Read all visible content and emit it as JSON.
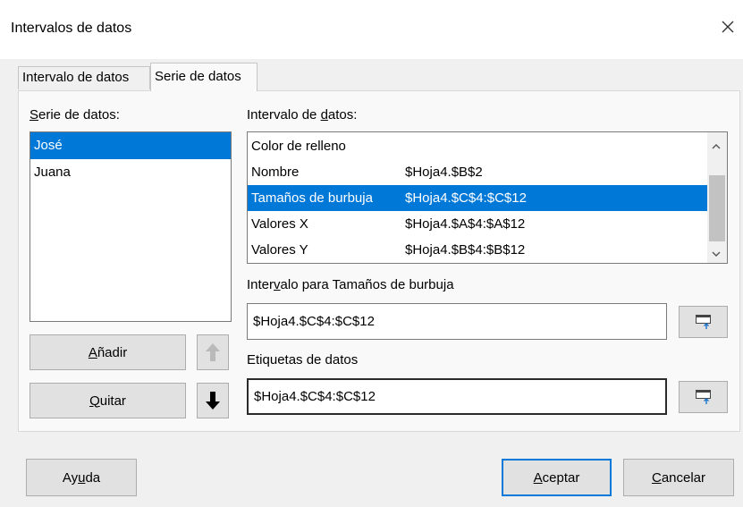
{
  "window": {
    "title": "Intervalos de datos"
  },
  "tabs": [
    {
      "label": "Intervalo de datos"
    },
    {
      "label": "Serie de datos"
    }
  ],
  "series": {
    "label": "Serie de datos:",
    "items": [
      {
        "label": "José"
      },
      {
        "label": "Juana"
      }
    ],
    "selected": "José"
  },
  "ranges": {
    "label": "Intervalo de datos:",
    "rows": [
      {
        "role": "Color de relleno",
        "range": ""
      },
      {
        "role": "Nombre",
        "range": "$Hoja4.$B$2"
      },
      {
        "role": "Tamaños de burbuja",
        "range": "$Hoja4.$C$4:$C$12"
      },
      {
        "role": "Valores X",
        "range": "$Hoja4.$A$4:$A$12"
      },
      {
        "role": "Valores Y",
        "range": "$Hoja4.$B$4:$B$12"
      }
    ]
  },
  "range_for": {
    "label": "Intervalo para Tamaños de burbuja",
    "value": "$Hoja4.$C$4:$C$12"
  },
  "data_labels": {
    "label": "Etiquetas de datos",
    "value": "$Hoja4.$C$4:$C$12"
  },
  "buttons": {
    "add": "Añadir",
    "remove": "Quitar",
    "help": "Ayuda",
    "ok": "Aceptar",
    "cancel": "Cancelar"
  },
  "icons": {
    "close": "close-icon",
    "up": "arrow-up-icon",
    "down": "arrow-down-icon",
    "select_range": "shrink-dialog-icon",
    "scroll_up": "chevron-up-icon",
    "scroll_down": "chevron-down-icon"
  },
  "colors": {
    "selection": "#0078d7",
    "default_button_border": "#0078d7"
  }
}
